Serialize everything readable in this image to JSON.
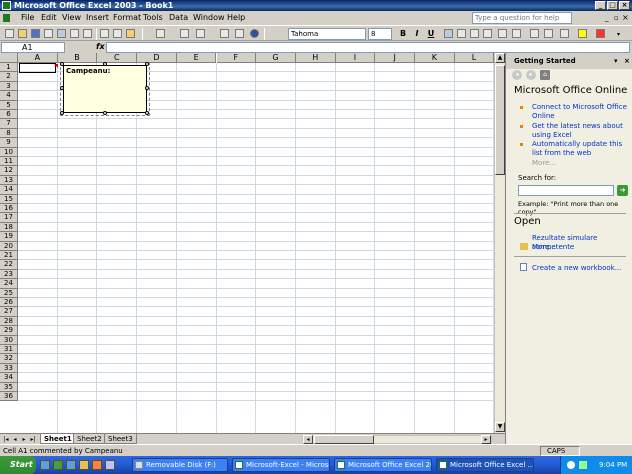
{
  "window": {
    "title": "Microsoft Office Excel 2003 - Book1"
  },
  "menu": {
    "items": [
      "File",
      "Edit",
      "View",
      "Insert",
      "Format",
      "Tools",
      "Data",
      "Window",
      "Help"
    ],
    "help_box": "Type a question for help"
  },
  "toolbar": {
    "font": "Tahoma",
    "size": "8",
    "bold": "B",
    "italic": "I",
    "underline": "U"
  },
  "formula_bar": {
    "name_box": "A1",
    "fx": "fx",
    "value": ""
  },
  "grid": {
    "columns": [
      "A",
      "B",
      "C",
      "D",
      "E",
      "F",
      "G",
      "H",
      "I",
      "J",
      "K",
      "L"
    ],
    "rows": [
      "1",
      "2",
      "3",
      "4",
      "5",
      "6",
      "7",
      "8",
      "9",
      "10",
      "11",
      "12",
      "13",
      "14",
      "15",
      "16",
      "17",
      "18",
      "19",
      "20",
      "21",
      "22",
      "23",
      "24",
      "25",
      "26",
      "27",
      "28",
      "29",
      "30",
      "31",
      "32",
      "33",
      "34",
      "35",
      "36"
    ]
  },
  "comment": {
    "text": "Campeanu:"
  },
  "sheets": [
    "Sheet1",
    "Sheet2",
    "Sheet3"
  ],
  "status": {
    "text": "Cell A1 commented by Campeanu",
    "caps": "CAPS"
  },
  "task_pane": {
    "header": "Getting Started",
    "online_title": "Microsoft Office Online",
    "links": [
      "Connect to Microsoft Office Online",
      "Get the latest news about using Excel",
      "Automatically update this list from the web"
    ],
    "more1": "More...",
    "search_label": "Search for:",
    "example": "Example:  \"Print more than one copy\"",
    "open_title": "Open",
    "open_items": [
      "Rezultate simulare competente",
      "More..."
    ],
    "create": "Create a new workbook..."
  },
  "taskbar": {
    "start": "Start",
    "tasks": [
      "Removable Disk (F:)",
      "Microsoft-Excel - Microso...",
      "Microsoft Office Excel 20...",
      "Microsoft Office Excel ..."
    ],
    "clock": "9:04 PM"
  }
}
